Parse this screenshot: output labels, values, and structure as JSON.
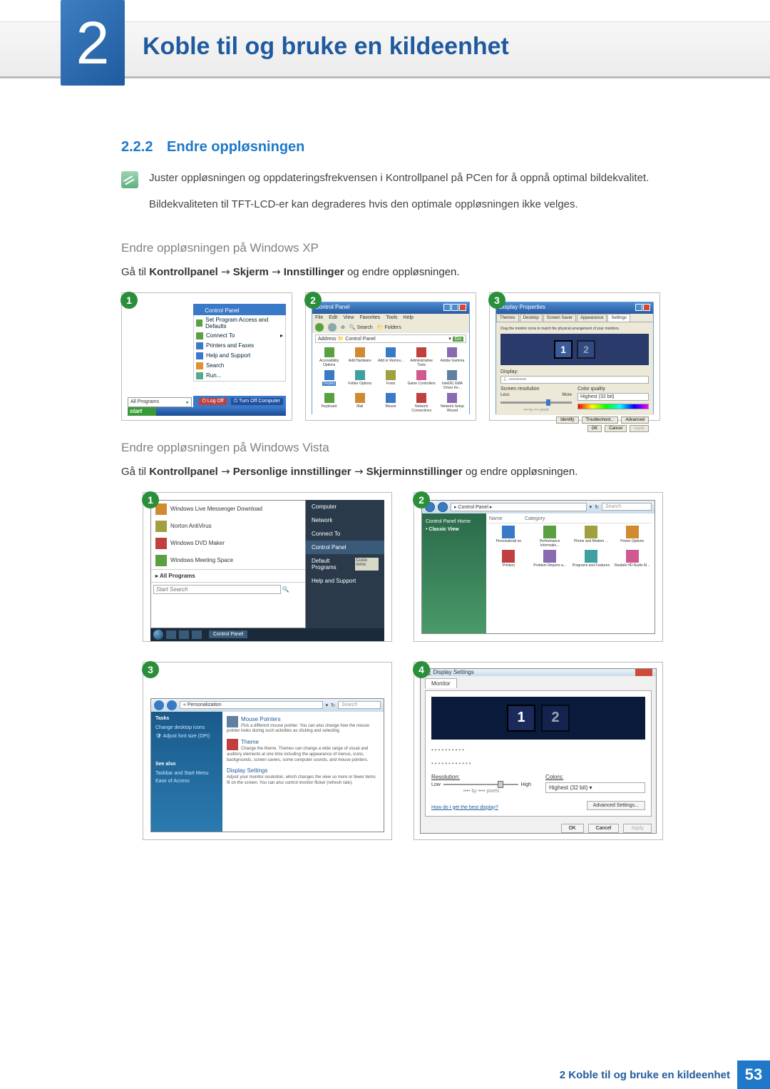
{
  "chapter": {
    "number": "2",
    "title": "Koble til og bruke en kildeenhet"
  },
  "section": {
    "number": "2.2.2",
    "title": "Endre oppløsningen"
  },
  "note": {
    "p1": "Juster oppløsningen og oppdateringsfrekvensen i Kontrollpanel på PCen for å oppnå optimal bildekvalitet.",
    "p2": "Bildekvaliteten til TFT-LCD-er kan degraderes hvis den optimale oppløsningen ikke velges."
  },
  "xp": {
    "heading": "Endre oppløsningen på Windows XP",
    "instr_prefix": "Gå til ",
    "instr_b1": "Kontrollpanel",
    "instr_b2": "Skjerm",
    "instr_b3": "Innstillinger",
    "instr_suffix": " og endre oppløsningen.",
    "steps": {
      "s1": "1",
      "s2": "2",
      "s3": "3"
    },
    "startmenu": {
      "header": "Control Panel",
      "items": [
        "Set Program Access and Defaults",
        "Connect To",
        "Printers and Faxes",
        "Help and Support",
        "Search",
        "Run..."
      ],
      "all_programs": "All Programs",
      "logoff": "Log Off",
      "turnoff": "Turn Off Computer",
      "start": "start"
    },
    "cp": {
      "title": "Control Panel",
      "menubar": [
        "File",
        "Edit",
        "View",
        "Favorites",
        "Tools",
        "Help"
      ],
      "toolbar": {
        "search": "Search",
        "folders": "Folders"
      },
      "address_label": "Address",
      "address": "Control Panel",
      "go": "Go",
      "icons": [
        "Accessibility Options",
        "Add Hardware",
        "Add or Remov...",
        "Administrative Tools",
        "Adobe Gamma",
        "Display",
        "Folder Options",
        "Fonts",
        "Game Controllers",
        "Intel(R) GMA Driver for...",
        "Keyboard",
        "Mail",
        "Mouse",
        "Network Connections",
        "Network Setup Wizard"
      ],
      "selected": "Display"
    },
    "dp": {
      "title": "Display Properties",
      "tabs": [
        "Themes",
        "Desktop",
        "Screen Saver",
        "Appearance",
        "Settings"
      ],
      "hint": "Drag the monitor icons to match the physical arrangement of your monitors.",
      "mon1": "1",
      "mon2": "2",
      "display_label": "Display:",
      "display_value": "1. ••••••••••",
      "res_label": "Screen resolution",
      "less": "Less",
      "more": "More",
      "res_value": "•••• by •••• pixels",
      "color_label": "Color quality",
      "color_value": "Highest (32 bit)",
      "btn_identify": "Identify",
      "btn_troubleshoot": "Troubleshoot...",
      "btn_advanced": "Advanced",
      "btn_ok": "OK",
      "btn_cancel": "Cancel",
      "btn_apply": "Apply"
    }
  },
  "vista": {
    "heading": "Endre oppløsningen på Windows Vista",
    "instr_prefix": "Gå til ",
    "instr_b1": "Kontrollpanel",
    "instr_b2": "Personlige innstillinger",
    "instr_b3": "Skjerminnstillinger",
    "instr_suffix": " og endre oppløsningen.",
    "steps": {
      "s1": "1",
      "s2": "2",
      "s3": "3",
      "s4": "4"
    },
    "start": {
      "items": [
        "Windows Live Messenger Download",
        "Norton AntiVirus",
        "Windows DVD Maker",
        "Windows Meeting Space"
      ],
      "all_programs": "All Programs",
      "search_ph": "Start Search",
      "right": [
        "Computer",
        "Network",
        "Connect To",
        "Control Panel",
        "Default Programs",
        "Help and Support"
      ],
      "right_extra": "Custo remo",
      "taskbar_cp": "Control Panel"
    },
    "cp": {
      "crumb": "▸ Control Panel ▸",
      "search_ph": "Search",
      "side_home": "Control Panel Home",
      "side_classic": "Classic View",
      "col_name": "Name",
      "col_cat": "Category",
      "icons": [
        "Personalizati on",
        "Performance Informatio...",
        "Phone and Modem ...",
        "Power Options",
        "Printers",
        "Problem Reports a...",
        "Programs and Features",
        "Realtek HD Audio M..."
      ]
    },
    "pers": {
      "crumb": "« Personalization",
      "search_ph": "Search",
      "tasks_h": "Tasks",
      "tasks": [
        "Change desktop icons",
        "Adjust font size (DPI)"
      ],
      "seealso_h": "See also",
      "seealso": [
        "Taskbar and Start Menu",
        "Ease of Access"
      ],
      "sec1_h": "Mouse Pointers",
      "sec1_d": "Pick a different mouse pointer. You can also change how the mouse pointer looks during such activities as clicking and selecting.",
      "sec2_h": "Theme",
      "sec2_d": "Change the theme. Themes can change a wide range of visual and auditory elements at one time including the appearance of menus, icons, backgrounds, screen savers, some computer sounds, and mouse pointers.",
      "sec3_h": "Display Settings",
      "sec3_d": "Adjust your monitor resolution, which changes the view so more or fewer items fit on the screen. You can also control monitor flicker (refresh rate)."
    },
    "ds": {
      "title": "Display Settings",
      "tab": "Monitor",
      "mon1": "1",
      "mon2": "2",
      "dots1": "••••••••••",
      "dots2": "••••••••••••",
      "res_label": "Resolution:",
      "low": "Low",
      "high": "High",
      "px": "•••• by •••• pixels",
      "color_label": "Colors:",
      "color_value": "Highest (32 bit)",
      "link": "How do I get the best display?",
      "adv": "Advanced Settings...",
      "ok": "OK",
      "cancel": "Cancel",
      "apply": "Apply"
    }
  },
  "footer": {
    "text": "2 Koble til og bruke en kildeenhet",
    "page": "53"
  },
  "arrow": "→"
}
